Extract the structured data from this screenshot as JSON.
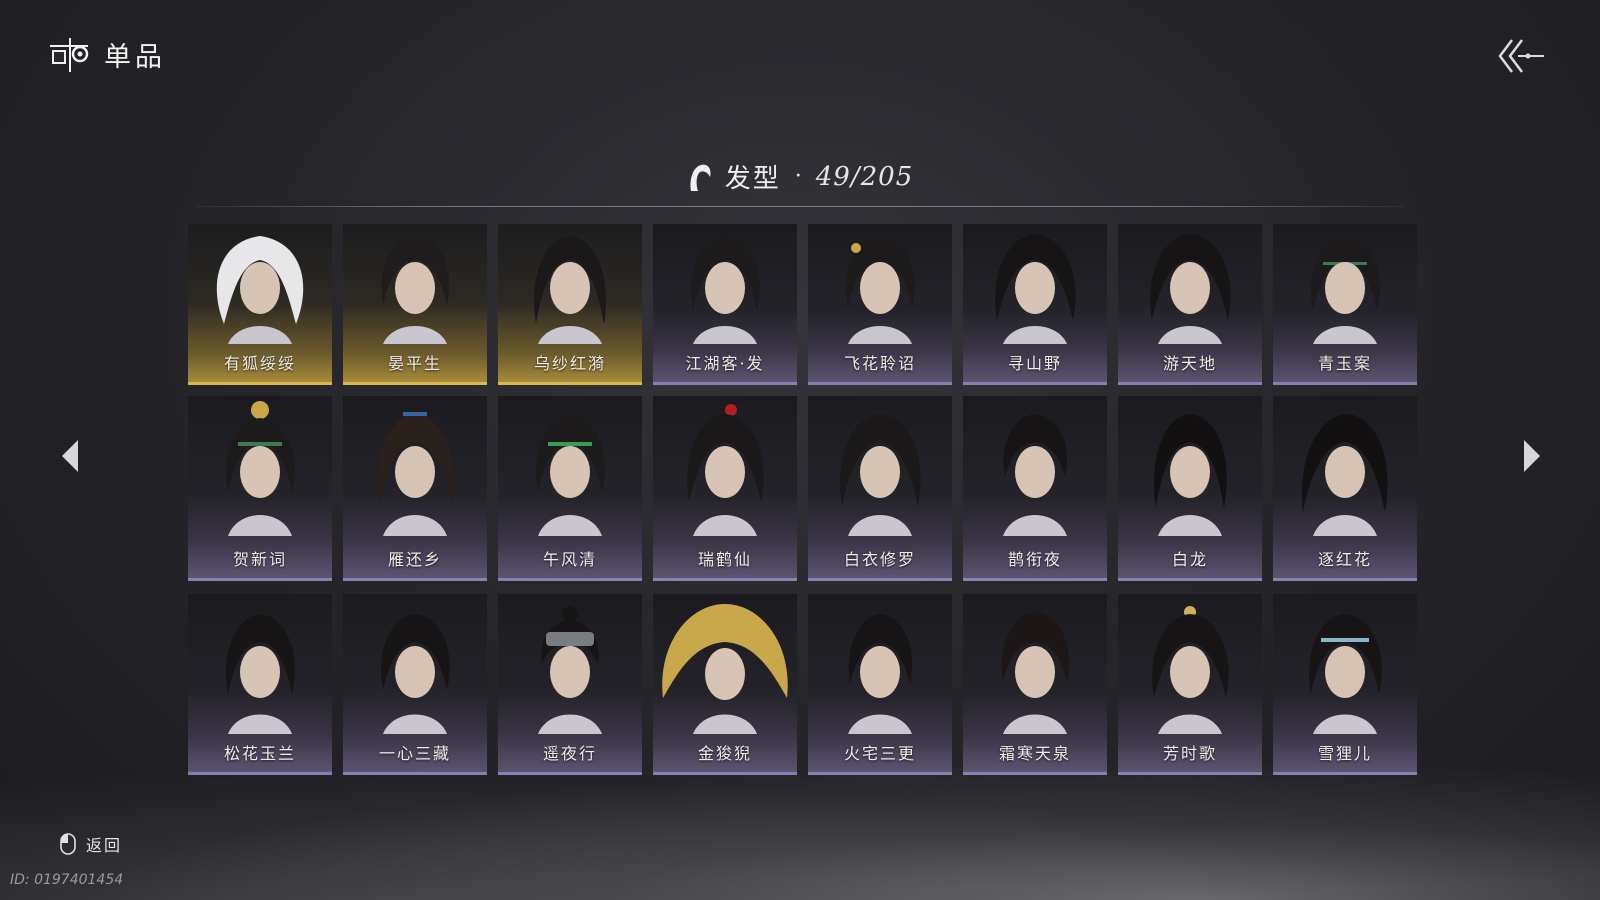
{
  "header": {
    "title": "单品",
    "logo_icon": "gift-lantern-icon"
  },
  "top_back_icon": "double-chevron-back-icon",
  "category": {
    "icon": "hair-icon",
    "label": "发型",
    "separator": "·",
    "count": "49/205"
  },
  "items": [
    {
      "label": "有狐绥绥",
      "rarity": "gold"
    },
    {
      "label": "晏平生",
      "rarity": "gold"
    },
    {
      "label": "乌纱红漪",
      "rarity": "gold"
    },
    {
      "label": "江湖客·发",
      "rarity": "purple"
    },
    {
      "label": "飞花聆诏",
      "rarity": "purple"
    },
    {
      "label": "寻山野",
      "rarity": "purple"
    },
    {
      "label": "游天地",
      "rarity": "purple"
    },
    {
      "label": "青玉案",
      "rarity": "purple"
    },
    {
      "label": "贺新词",
      "rarity": "purple"
    },
    {
      "label": "雁还乡",
      "rarity": "purple"
    },
    {
      "label": "午风清",
      "rarity": "purple"
    },
    {
      "label": "瑞鹤仙",
      "rarity": "purple"
    },
    {
      "label": "白衣修罗",
      "rarity": "purple"
    },
    {
      "label": "鹊衔夜",
      "rarity": "purple"
    },
    {
      "label": "白龙",
      "rarity": "purple"
    },
    {
      "label": "逐红花",
      "rarity": "purple"
    },
    {
      "label": "松花玉兰",
      "rarity": "purple"
    },
    {
      "label": "一心三藏",
      "rarity": "purple"
    },
    {
      "label": "遥夜行",
      "rarity": "purple"
    },
    {
      "label": "金狻猊",
      "rarity": "purple"
    },
    {
      "label": "火宅三更",
      "rarity": "purple"
    },
    {
      "label": "霜寒天泉",
      "rarity": "purple"
    },
    {
      "label": "芳时歌",
      "rarity": "purple"
    },
    {
      "label": "雪狸儿",
      "rarity": "purple"
    }
  ],
  "nav": {
    "prev_icon": "arrow-left-icon",
    "next_icon": "arrow-right-icon"
  },
  "footer": {
    "hint_icon": "mouse-icon",
    "return_label": "返回",
    "id_text": "ID: 0197401454"
  },
  "colors": {
    "gold": "#d9b84e",
    "purple": "#8a7fb0",
    "background": "#26262b"
  }
}
